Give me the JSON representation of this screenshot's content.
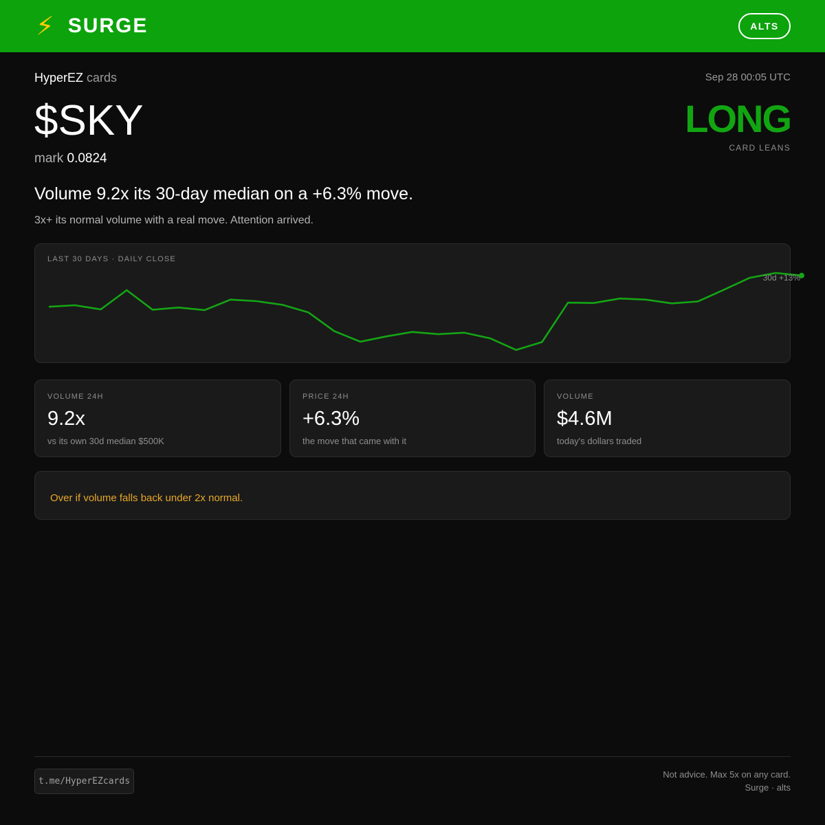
{
  "header": {
    "brand_icon": "lightning-bolt-icon",
    "bolt_glyph": "⚡",
    "brand": "SURGE",
    "alts_label": "ALTS",
    "accent_color": "#0ca30c"
  },
  "card": {
    "source_name": "HyperEZ",
    "source_suffix": "cards",
    "timestamp": "Sep 28 00:05 UTC",
    "ticker": "$SKY",
    "mark_label": "mark",
    "mark_value": "0.0824",
    "lean": "LONG",
    "lean_label": "CARD LEANS",
    "lean_color": "#12a512",
    "headline": "Volume 9.2x its 30-day median on a +6.3% move.",
    "subline": "3x+ its normal volume with a real move. Attention arrived."
  },
  "chart_data": {
    "type": "line",
    "title": "LAST 30 DAYS · DAILY CLOSE",
    "change_label": "30d +13%",
    "line_color": "#14a514",
    "series": [
      {
        "values": [
          0.0745,
          0.0749,
          0.0738,
          0.0789,
          0.0737,
          0.0743,
          0.0736,
          0.0764,
          0.076,
          0.075,
          0.073,
          0.068,
          0.0652,
          0.0666,
          0.0678,
          0.0672,
          0.0676,
          0.0661,
          0.063,
          0.0651,
          0.0756,
          0.0755,
          0.0767,
          0.0764,
          0.0754,
          0.0759,
          0.079,
          0.0822,
          0.0835,
          0.0828
        ]
      }
    ]
  },
  "stats": [
    {
      "label": "VOLUME 24H",
      "value": "9.2x",
      "note": "vs its own 30d median $500K"
    },
    {
      "label": "PRICE 24H",
      "value": "+6.3%",
      "note": "the move that came with it"
    },
    {
      "label": "VOLUME",
      "value": "$4.6M",
      "note": "today's dollars traded"
    }
  ],
  "exit_condition": "Over if volume falls back under 2x normal.",
  "exit_color": "#e8a82a",
  "footer": {
    "link": "t.me/HyperEZcards",
    "disclaimer_line1": "Not advice. Max 5x on any card.",
    "disclaimer_line2": "Surge · alts"
  }
}
